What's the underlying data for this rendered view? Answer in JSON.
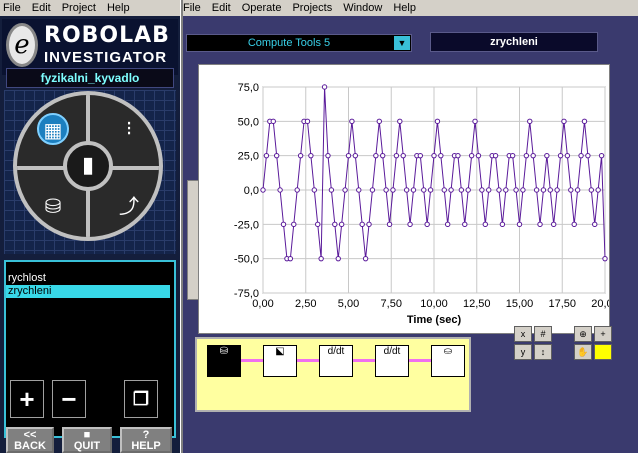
{
  "menus": {
    "left": [
      "File",
      "Edit",
      "Project",
      "Help"
    ],
    "right": [
      "File",
      "Edit",
      "Operate",
      "Projects",
      "Window",
      "Help"
    ]
  },
  "logo": {
    "line1": "ROBOLAB",
    "line2": "INVESTIGATOR"
  },
  "program_name": "fyzikalni_kyvadlo",
  "data_list": [
    "rychlost",
    "zrychleni"
  ],
  "selected_item": "zrychleni",
  "nav_buttons": [
    {
      "top": "<<",
      "bottom": "BACK"
    },
    {
      "top": "■",
      "bottom": "QUIT"
    },
    {
      "top": "?",
      "bottom": "HELP"
    }
  ],
  "compute_selector": "Compute Tools 5",
  "active_tab": "zrychleni",
  "chart_data": {
    "type": "line",
    "xlabel": "Time (sec)",
    "xlim": [
      0,
      20
    ],
    "ylim": [
      -75,
      75
    ],
    "xticks": [
      "0,00",
      "2,50",
      "5,00",
      "7,50",
      "10,00",
      "12,50",
      "15,00",
      "17,50",
      "20,00"
    ],
    "yticks": [
      "75,0",
      "50,0",
      "25,0",
      "0,0",
      "-25,0",
      "-50,0",
      "-75,0"
    ],
    "series": [
      {
        "color": "#5a1a9a",
        "x": [
          0,
          0.2,
          0.4,
          0.6,
          0.8,
          1.0,
          1.2,
          1.4,
          1.6,
          1.8,
          2.0,
          2.2,
          2.4,
          2.6,
          2.8,
          3.0,
          3.2,
          3.4,
          3.6,
          3.8,
          4.0,
          4.2,
          4.4,
          4.6,
          4.8,
          5.0,
          5.2,
          5.4,
          5.6,
          5.8,
          6.0,
          6.2,
          6.4,
          6.6,
          6.8,
          7.0,
          7.2,
          7.4,
          7.6,
          7.8,
          8.0,
          8.2,
          8.4,
          8.6,
          8.8,
          9.0,
          9.2,
          9.4,
          9.6,
          9.8,
          10.0,
          10.2,
          10.4,
          10.6,
          10.8,
          11.0,
          11.2,
          11.4,
          11.6,
          11.8,
          12.0,
          12.2,
          12.4,
          12.6,
          12.8,
          13.0,
          13.2,
          13.4,
          13.6,
          13.8,
          14.0,
          14.2,
          14.4,
          14.6,
          14.8,
          15.0,
          15.2,
          15.4,
          15.6,
          15.8,
          16.0,
          16.2,
          16.4,
          16.6,
          16.8,
          17.0,
          17.2,
          17.4,
          17.6,
          17.8,
          18.0,
          18.2,
          18.4,
          18.6,
          18.8,
          19.0,
          19.2,
          19.4,
          19.6,
          19.8,
          20.0
        ],
        "y": [
          0,
          25,
          50,
          50,
          25,
          0,
          -25,
          -50,
          -50,
          -25,
          0,
          25,
          50,
          50,
          25,
          0,
          -25,
          -50,
          75,
          25,
          0,
          -25,
          -50,
          -25,
          0,
          25,
          50,
          25,
          0,
          -25,
          -50,
          -25,
          0,
          25,
          50,
          25,
          0,
          -25,
          0,
          25,
          50,
          25,
          0,
          -25,
          0,
          25,
          25,
          0,
          -25,
          0,
          25,
          50,
          25,
          0,
          -25,
          0,
          25,
          25,
          0,
          -25,
          0,
          25,
          50,
          25,
          0,
          -25,
          0,
          25,
          25,
          0,
          -25,
          0,
          25,
          25,
          0,
          -25,
          0,
          25,
          50,
          25,
          0,
          -25,
          0,
          25,
          0,
          -25,
          0,
          25,
          50,
          25,
          0,
          -25,
          0,
          25,
          50,
          25,
          0,
          -25,
          0,
          25,
          -50
        ]
      }
    ]
  },
  "pipeline": {
    "blocks": [
      {
        "label": "",
        "icon": "cans-icon"
      },
      {
        "label": "",
        "icon": "graph-select-icon"
      },
      {
        "label": "d/dt",
        "icon": "derivative-icon"
      },
      {
        "label": "d/dt",
        "icon": "derivative-icon"
      },
      {
        "label": "",
        "icon": "bucket-icon"
      }
    ]
  }
}
